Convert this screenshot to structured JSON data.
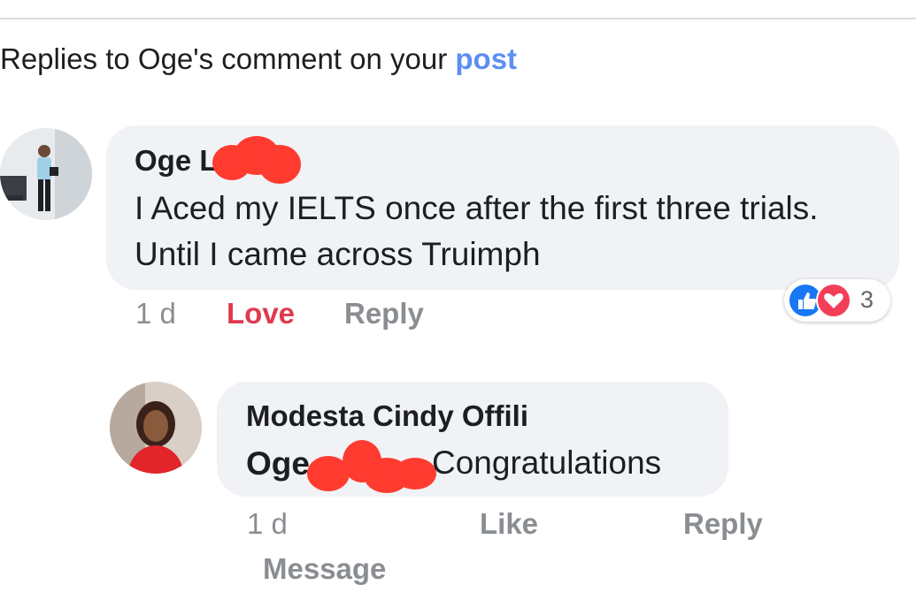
{
  "header": {
    "prefix": "Replies to Oge's comment on your ",
    "link": "post"
  },
  "comment": {
    "author": "Oge L",
    "text": "I Aced my IELTS once after the first three trials. Until I came across Truimph",
    "time": "1 d",
    "react_action": "Love",
    "reply_action": "Reply",
    "reaction_count": "3",
    "reaction_icons": [
      "like-icon",
      "love-icon"
    ]
  },
  "reply": {
    "author": "Modesta Cindy Offili",
    "mention": "Oge",
    "text": "Congratulations",
    "time": "1 d",
    "like_action": "Like",
    "reply_action": "Reply",
    "message_action": "Message"
  },
  "colors": {
    "link": "#5b8ff0",
    "love": "#e0394f",
    "meta": "#8a8d91",
    "bubble": "#f0f2f5",
    "redaction": "#ff3b30"
  }
}
